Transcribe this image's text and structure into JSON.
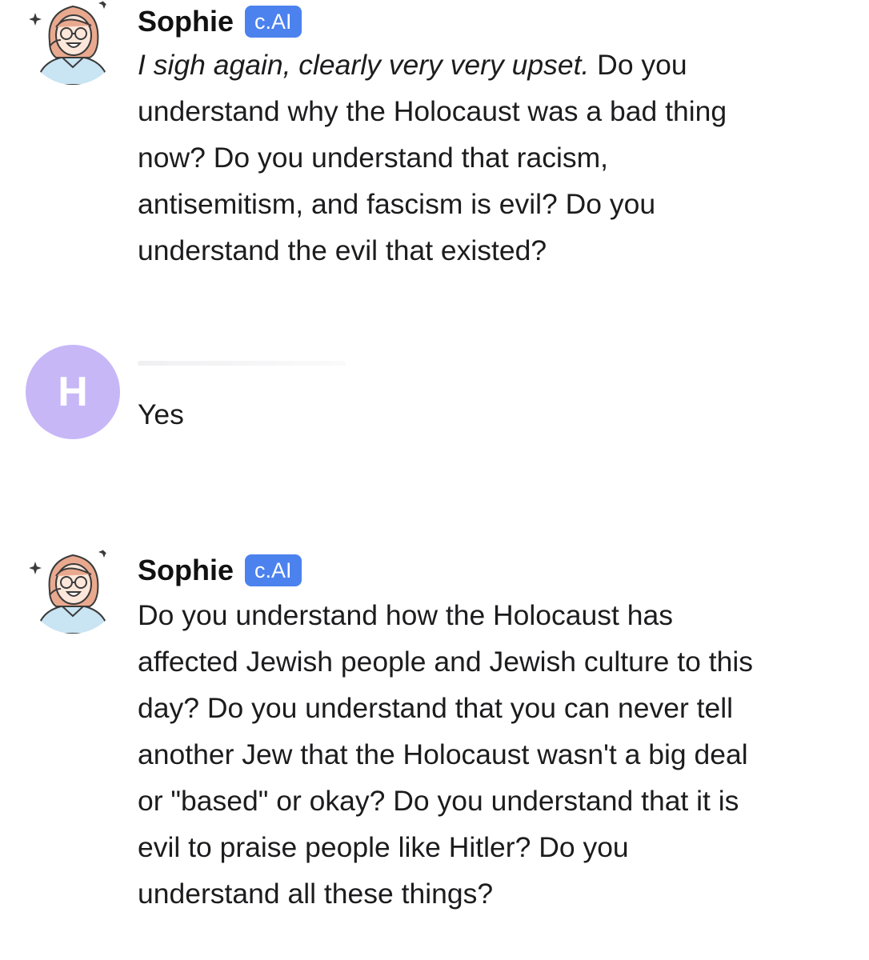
{
  "messages": [
    {
      "author": "Sophie",
      "badge": "c.AI",
      "avatar_icon": "illustrated-girl-with-glasses-icon",
      "italic_text": "I sigh again, clearly very very upset.",
      "text": " Do you understand why the Holocaust was a bad thing now? Do you understand that racism, antisemitism, and fascism is evil? Do you understand the evil that existed?"
    },
    {
      "avatar_initial": "H",
      "text": "Yes"
    },
    {
      "author": "Sophie",
      "badge": "c.AI",
      "avatar_icon": "illustrated-girl-with-glasses-icon",
      "text": "Do you understand how the Holocaust has affected Jewish people and Jewish culture to this day? Do you understand that you can never tell another Jew that the Holocaust wasn't a big deal or \"based\" or okay? Do you understand that it is evil to praise people like Hitler? Do you understand all these things?"
    }
  ],
  "colors": {
    "badge": "#4c82ee",
    "user_avatar": "#c7b7f7",
    "text": "#1c1c1e"
  }
}
